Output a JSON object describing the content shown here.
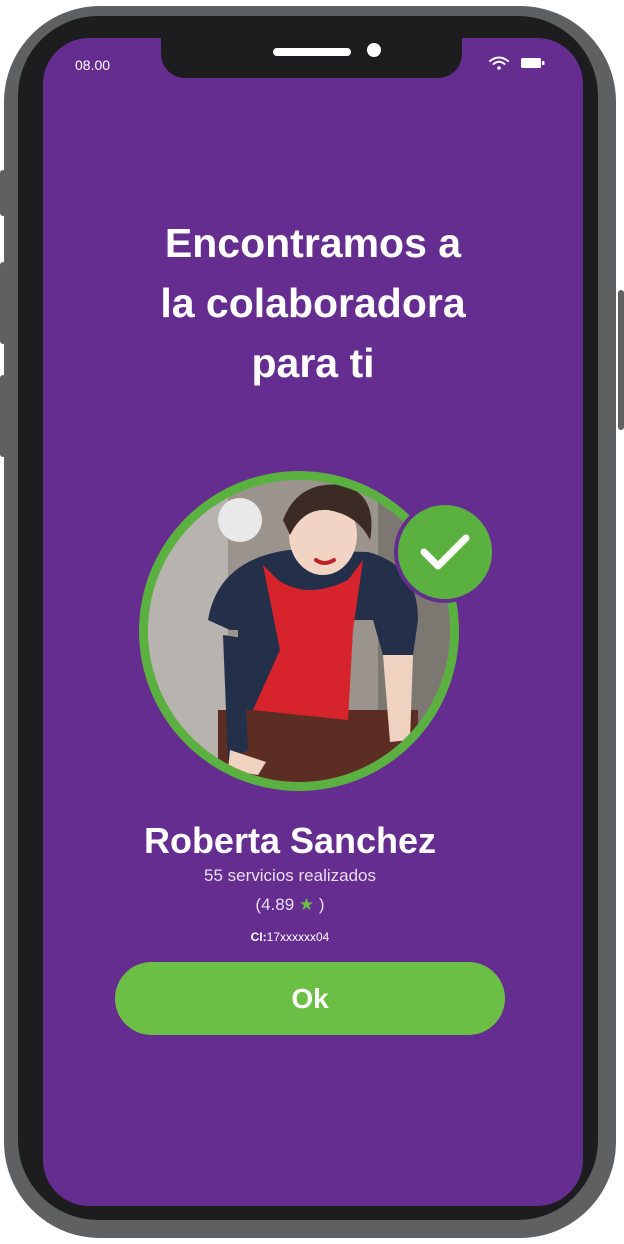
{
  "status_bar": {
    "time": "08.00",
    "icons": [
      "wifi-icon",
      "battery-icon"
    ]
  },
  "match": {
    "title_lines": [
      "Encontramos a",
      "la colaboradora",
      "para ti"
    ],
    "collaborator": {
      "name": "Roberta Sanchez",
      "services": "55 servicios realizados",
      "rating_open": "(4.89",
      "rating_close": ")",
      "ci_label": "CI:",
      "ci_value": "17xxxxxx04"
    },
    "ok_label": "Ok"
  },
  "colors": {
    "background": "#662d91",
    "accent": "#6cbf45",
    "ring": "#5bb13f",
    "text": "#ffffff"
  }
}
